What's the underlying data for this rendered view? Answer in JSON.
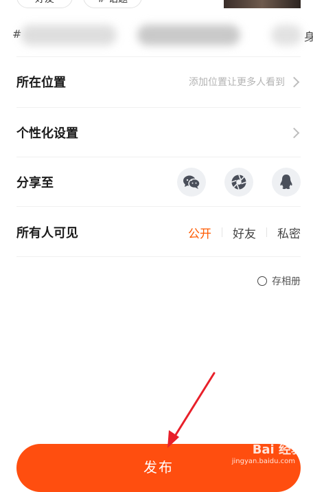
{
  "top": {
    "chip_left_label": "好友",
    "chip_right_label": "# 话题",
    "edge_left": "#",
    "edge_right": "身"
  },
  "settings": {
    "location": {
      "label": "所在位置",
      "hint": "添加位置让更多人看到"
    },
    "personalize": {
      "label": "个性化设置"
    },
    "share": {
      "label": "分享至",
      "targets": [
        "wechat-icon",
        "moments-icon",
        "qq-icon"
      ]
    },
    "visibility": {
      "label": "所有人可见",
      "options": [
        "公开",
        "好友",
        "私密"
      ],
      "selected": "公开"
    },
    "save_album": {
      "label": "存相册"
    }
  },
  "publish": {
    "label": "发布"
  },
  "watermark": {
    "text": "Bai 经验",
    "sub": "jingyan.baidu.com"
  },
  "colors": {
    "accent": "#ff5a00",
    "button": "#ff4e0f",
    "annotation_arrow": "#e8202a"
  }
}
